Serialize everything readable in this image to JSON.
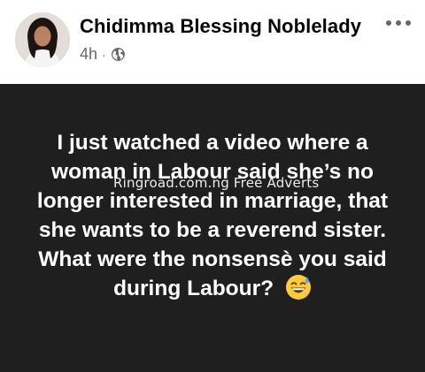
{
  "post": {
    "author_name": "Chidimma Blessing Noblelady",
    "time": "4h",
    "separator": "·",
    "audience_icon": "globe-icon",
    "more_icon": "more-options-icon"
  },
  "status": {
    "background": "#1f1f1f",
    "text": "I just watched a video where a woman in Labour said she’s no longer interested in marriage, that she wants to be a reverend sister. What were the nonsensè you said during Labour?",
    "emoji": "grinning-face-with-sweat-icon",
    "watermark": "Ringroad.com.ng Free Adverts"
  }
}
